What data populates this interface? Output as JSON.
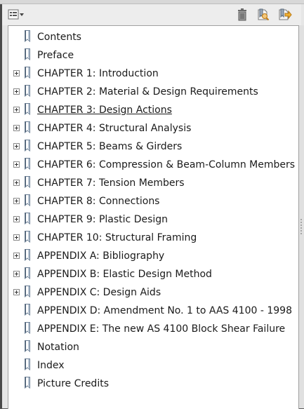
{
  "toolbar": {
    "options_icon": "options-menu-icon",
    "delete_icon": "trash-icon",
    "find_icon": "find-bookmark-icon",
    "expand_icon": "expand-bookmark-icon"
  },
  "bookmarks": [
    {
      "label": "Contents",
      "expandable": false
    },
    {
      "label": "Preface",
      "expandable": false
    },
    {
      "label": "CHAPTER 1: Introduction",
      "expandable": true
    },
    {
      "label": "CHAPTER 2: Material & Design Requirements",
      "expandable": true
    },
    {
      "label": "CHAPTER 3: Design Actions",
      "expandable": true,
      "hover": true
    },
    {
      "label": "CHAPTER 4: Structural Analysis",
      "expandable": true
    },
    {
      "label": "CHAPTER 5: Beams & Girders",
      "expandable": true
    },
    {
      "label": "CHAPTER 6: Compression & Beam-Column Members",
      "expandable": true
    },
    {
      "label": "CHAPTER 7: Tension Members",
      "expandable": true
    },
    {
      "label": "CHAPTER 8: Connections",
      "expandable": true
    },
    {
      "label": "CHAPTER 9: Plastic Design",
      "expandable": true
    },
    {
      "label": "CHAPTER 10: Structural Framing",
      "expandable": true
    },
    {
      "label": "APPENDIX A: Bibliography",
      "expandable": true
    },
    {
      "label": "APPENDIX B: Elastic Design Method",
      "expandable": true
    },
    {
      "label": "APPENDIX C: Design Aids",
      "expandable": true
    },
    {
      "label": "APPENDIX D: Amendment No. 1 to AAS 4100 - 1998",
      "expandable": false
    },
    {
      "label": "APPENDIX E: The new AS 4100 Block Shear Failure",
      "expandable": false
    },
    {
      "label": "Notation",
      "expandable": false
    },
    {
      "label": "Index",
      "expandable": false
    },
    {
      "label": "Picture Credits",
      "expandable": false
    }
  ]
}
